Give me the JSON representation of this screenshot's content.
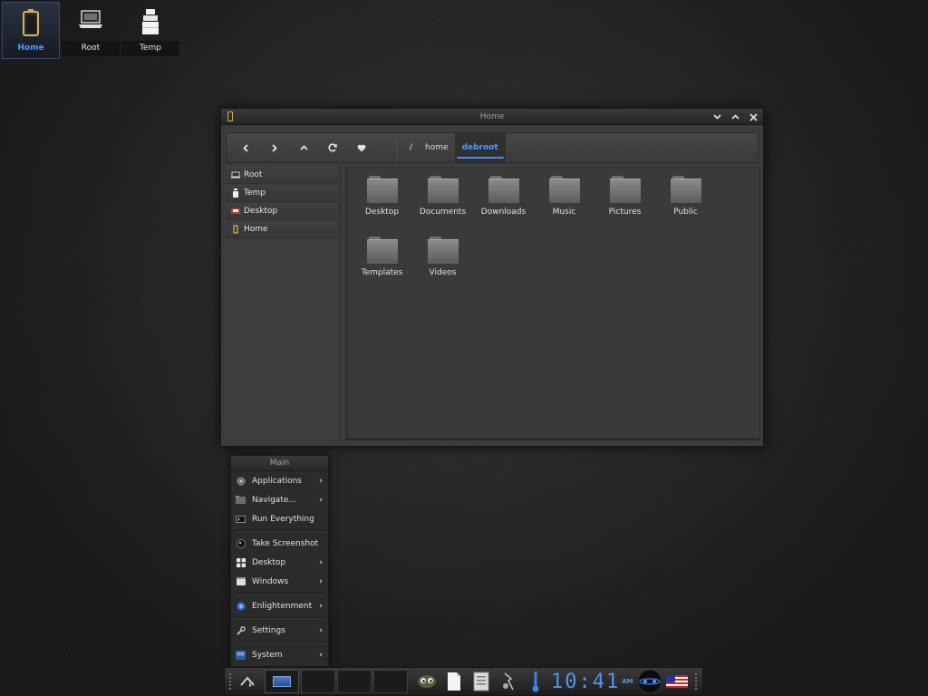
{
  "desktop_icons": [
    {
      "label": "Home",
      "icon": "home-battery-icon",
      "selected": true
    },
    {
      "label": "Root",
      "icon": "laptop-icon"
    },
    {
      "label": "Temp",
      "icon": "trash-bin-icon"
    }
  ],
  "window": {
    "title": "Home",
    "nav_buttons": [
      "back",
      "forward",
      "up",
      "refresh",
      "favorites"
    ],
    "breadcrumb": [
      "/",
      "home",
      "debroot"
    ],
    "sidebar": [
      {
        "label": "Root",
        "icon": "drive-icon"
      },
      {
        "label": "Temp",
        "icon": "trash-icon"
      },
      {
        "label": "Desktop",
        "icon": "desktop-icon"
      },
      {
        "label": "Home",
        "icon": "home-icon"
      }
    ],
    "folders": [
      "Desktop",
      "Documents",
      "Downloads",
      "Music",
      "Pictures",
      "Public",
      "Templates",
      "Videos"
    ]
  },
  "menu": {
    "title": "Main",
    "items": [
      {
        "label": "Applications",
        "icon": "applications-icon",
        "submenu": true
      },
      {
        "label": "Navigate...",
        "icon": "navigate-icon",
        "submenu": true
      },
      {
        "label": "Run Everything",
        "icon": "terminal-icon",
        "submenu": false
      },
      {
        "separator": true
      },
      {
        "label": "Take Screenshot",
        "icon": "camera-icon",
        "submenu": false
      },
      {
        "label": "Desktop",
        "icon": "grid-icon",
        "submenu": true
      },
      {
        "label": "Windows",
        "icon": "window-icon",
        "submenu": true
      },
      {
        "separator": true
      },
      {
        "label": "Enlightenment",
        "icon": "enlightenment-icon",
        "submenu": true
      },
      {
        "separator": true
      },
      {
        "label": "Settings",
        "icon": "wrench-icon",
        "submenu": true
      },
      {
        "separator": true
      },
      {
        "label": "System",
        "icon": "system-icon",
        "submenu": true
      }
    ]
  },
  "shelf": {
    "clock": "10:41",
    "ampm": "AM",
    "virtual_desktops": 4,
    "active_desktop": 1
  },
  "colors": {
    "accent": "#4a9dff",
    "clock": "#4f95f2"
  }
}
